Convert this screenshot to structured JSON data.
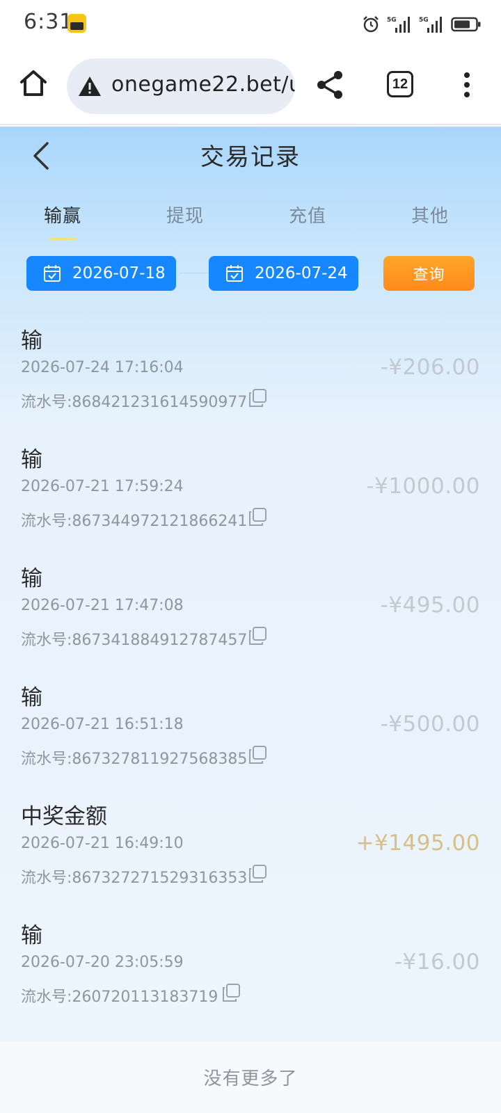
{
  "status_bar": {
    "time": "6:31",
    "app_icon": "notification-app-icon",
    "icons": [
      "alarm-icon",
      "signal-5g-icon",
      "signal-5g-icon",
      "battery-icon"
    ]
  },
  "browser": {
    "url": "onegame22.bet/u",
    "tab_count": "12",
    "icons": {
      "home": "home-icon",
      "warning": "warning-icon",
      "share": "share-icon",
      "more": "more-vertical-icon"
    }
  },
  "header": {
    "title": "交易记录",
    "back_icon": "chevron-left-icon"
  },
  "tabs": [
    {
      "label": "输赢",
      "active": true
    },
    {
      "label": "提现",
      "active": false
    },
    {
      "label": "充值",
      "active": false
    },
    {
      "label": "其他",
      "active": false
    }
  ],
  "filter": {
    "start_date": "2026-07-18",
    "end_date": "2026-07-24",
    "query_label": "查询",
    "calendar_icon": "calendar-icon"
  },
  "records": [
    {
      "type": "输",
      "time": "2026-07-24 17:16:04",
      "serial": "流水号:868421231614590977",
      "amount": "-¥206.00",
      "win": false
    },
    {
      "type": "输",
      "time": "2026-07-21 17:59:24",
      "serial": "流水号:867344972121866241",
      "amount": "-¥1000.00",
      "win": false
    },
    {
      "type": "输",
      "time": "2026-07-21 17:47:08",
      "serial": "流水号:867341884912787457",
      "amount": "-¥495.00",
      "win": false
    },
    {
      "type": "输",
      "time": "2026-07-21 16:51:18",
      "serial": "流水号:867327811927568385",
      "amount": "-¥500.00",
      "win": false
    },
    {
      "type": "中奖金额",
      "time": "2026-07-21 16:49:10",
      "serial": "流水号:867327271529316353",
      "amount": "+¥1495.00",
      "win": true
    },
    {
      "type": "输",
      "time": "2026-07-20 23:05:59",
      "serial": "流水号:260720113183719",
      "amount": "-¥16.00",
      "win": false
    }
  ],
  "footer": {
    "no_more": "没有更多了"
  },
  "colors": {
    "primary_blue": "#1787ff",
    "query_orange": "#ff8a1a",
    "loss_amount": "#c2c9d0",
    "win_amount": "#d6c08a"
  }
}
